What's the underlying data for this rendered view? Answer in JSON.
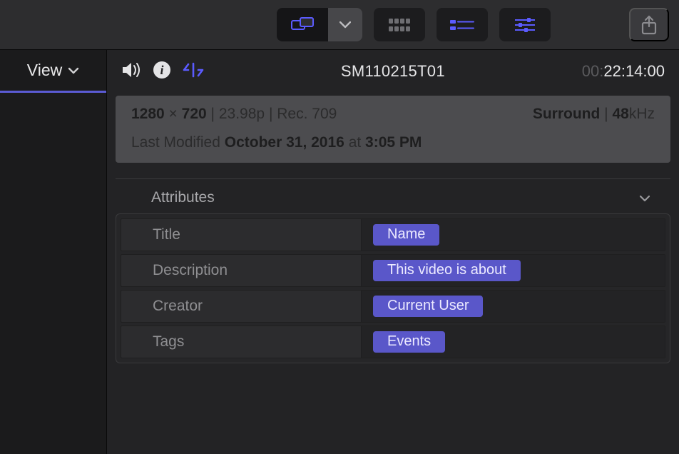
{
  "sidebar": {
    "view_tab": "View"
  },
  "clip": {
    "title": "SM110215T01",
    "timecode_dim": "00:",
    "timecode_main": "22:14:00"
  },
  "meta": {
    "res_w": "1280",
    "res_h": "720",
    "fps": "23.98p",
    "colorspace": "Rec. 709",
    "audio_mode": "Surround",
    "audio_rate_num": "48",
    "audio_rate_unit": "kHz",
    "modified_label": "Last Modified",
    "modified_date": "October 31, 2016",
    "modified_at": "at",
    "modified_time": "3:05 PM"
  },
  "section": {
    "attributes_label": "Attributes"
  },
  "attrs": {
    "title_label": "Title",
    "title_value": "Name",
    "description_label": "Description",
    "description_value": "This video is about",
    "creator_label": "Creator",
    "creator_value": "Current User",
    "tags_label": "Tags",
    "tags_value": "Events"
  }
}
